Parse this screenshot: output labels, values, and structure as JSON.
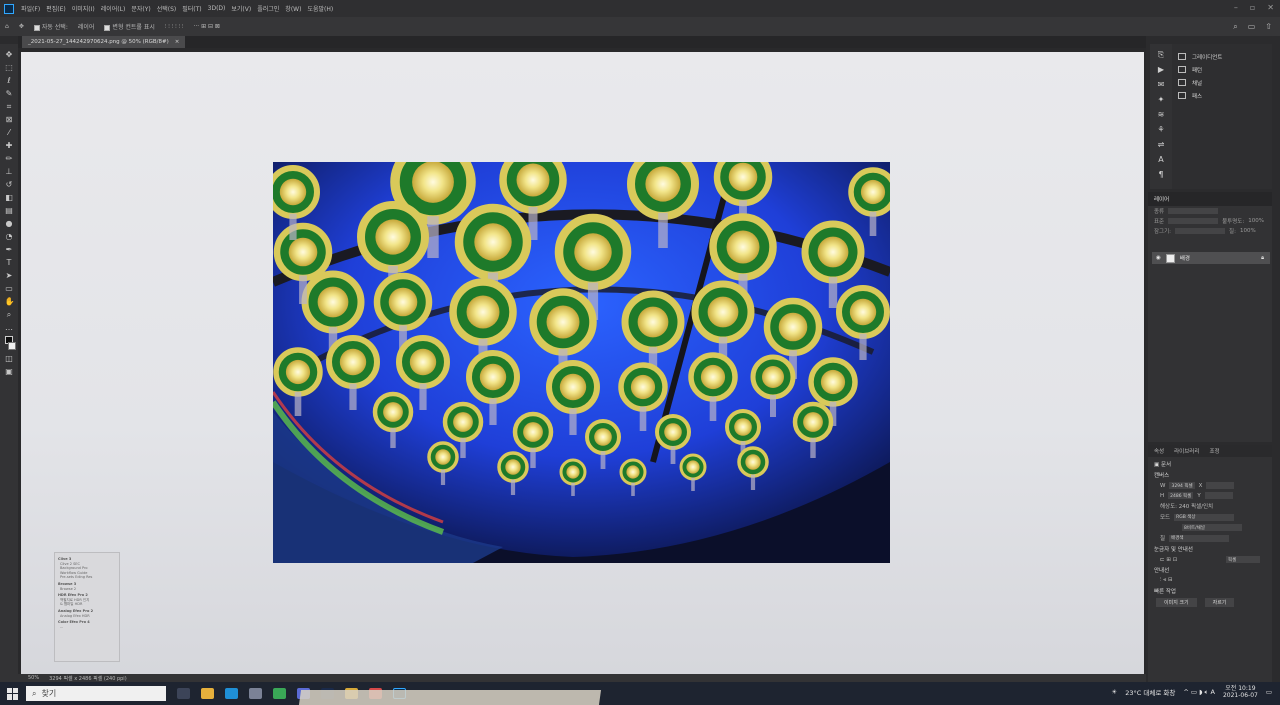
{
  "menu": [
    "파일(F)",
    "편집(E)",
    "이미지(I)",
    "레이어(L)",
    "문자(Y)",
    "선택(S)",
    "필터(T)",
    "3D(D)",
    "보기(V)",
    "플러그인",
    "창(W)",
    "도움말(H)"
  ],
  "options": {
    "auto_select": "자동 선택:",
    "layer_select": "레이어",
    "transform_controls": "변형 컨트롤 표시"
  },
  "document_tab": {
    "title": "_2021-05-27_144242970624.png @ 50% (RGB/8#)",
    "close": "×"
  },
  "info_panel": {
    "sections": [
      {
        "title": "Clive 3",
        "rows": [
          "Clive 2    SEC",
          "Background   Pro",
          "Workflow    Guide",
          "Pre-sets    Eding Res"
        ]
      },
      {
        "title": "Browse 3",
        "rows": [
          "Browse 2"
        ]
      },
      {
        "title": "HDR Efex Pro 2",
        "rows": [
          "백필지로 HDR 인지",
          "& 웹파일 HDR"
        ]
      },
      {
        "title": "Analog Efex Pro 2",
        "rows": [
          "Analog Efex HDR"
        ]
      },
      {
        "title": "Color Efex Pro 4",
        "rows": [
          "..."
        ]
      }
    ]
  },
  "status_bar": {
    "zoom": "50%",
    "dimensions": "3294 픽셀 x 2486 픽셀 (240 ppi)"
  },
  "right_mini_panels": [
    {
      "icon": "gradient-icon",
      "label": "그레이디언트"
    },
    {
      "icon": "swatches-icon",
      "label": "패턴"
    },
    {
      "icon": "channels-icon",
      "label": "채널"
    },
    {
      "icon": "paths-icon",
      "label": "패스"
    }
  ],
  "layers": {
    "tab": "레이어",
    "kind_label": "종류",
    "mode_label": "표준",
    "opacity_label": "불투명도:",
    "opacity_value": "100%",
    "lock_label": "잠그기:",
    "fill_label": "칠:",
    "fill_value": "100%",
    "layer_name": "배경"
  },
  "properties": {
    "tabs": [
      "속성",
      "라이브러리",
      "조정"
    ],
    "doc_label": "문서",
    "canvas_section": "캔버스",
    "w_label": "W",
    "w_value": "3294 픽셀",
    "h_label": "H",
    "h_value": "2486 픽셀",
    "x_label": "X",
    "y_label": "Y",
    "resolution": "해상도: 240 픽셀/인치",
    "mode_label": "모드",
    "mode_value": "RGB 색상",
    "depth_value": "8비트/채널",
    "fill_label": "칠",
    "fill_value": "배경색",
    "rulers_section": "눈금자 및 안내선",
    "unit_value": "픽셀",
    "guides_section": "안내선",
    "quick_actions": "빠른 작업",
    "image_size_button": "이미지 크기",
    "crop_button": "자르기"
  },
  "taskbar": {
    "search_placeholder": "찾기",
    "weather": "23°C 대체로 화창",
    "time": "오전 10:19",
    "date": "2021-06-07"
  },
  "colors": {
    "accent": "#31a8ff",
    "panel": "#323234",
    "canvas": "#e9e9ec"
  }
}
